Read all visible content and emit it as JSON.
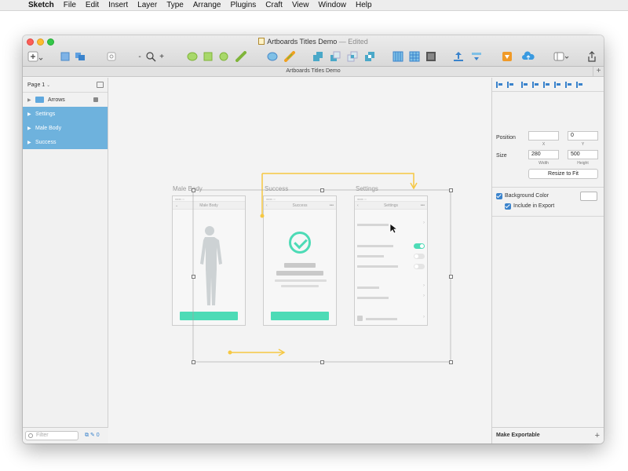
{
  "menubar": {
    "app": "Sketch",
    "items": [
      "File",
      "Edit",
      "Insert",
      "Layer",
      "Type",
      "Arrange",
      "Plugins",
      "Craft",
      "View",
      "Window",
      "Help"
    ]
  },
  "window": {
    "title": "Artboards Titles Demo",
    "edited": "— Edited",
    "tab_title": "Artboards Titles Demo"
  },
  "toolbar": {
    "icons": [
      "insert-icon",
      "group-icon",
      "ungroup-icon",
      "create-symbol-icon",
      "zoom-out-icon",
      "zoom-icon",
      "zoom-in-icon",
      "edit-icon",
      "transform-icon",
      "rotate-icon",
      "flatten-icon",
      "mask-icon",
      "scale-icon",
      "union-icon",
      "subtract-icon",
      "intersect-icon",
      "difference-icon",
      "forward-icon",
      "backward-icon",
      "mirror-icon",
      "view-icon",
      "export-icon",
      "cloud-icon",
      "sketch-icon"
    ],
    "zoom_minus": "-",
    "zoom_plus": "+"
  },
  "leftpanel": {
    "page_label": "Page 1",
    "layers": [
      {
        "label": "Arrows",
        "selected": false,
        "locked": true
      },
      {
        "label": "Settings",
        "selected": true
      },
      {
        "label": "Male Body",
        "selected": true
      },
      {
        "label": "Success",
        "selected": true
      }
    ],
    "filter_placeholder": "Filter",
    "footer_count": "0"
  },
  "canvas": {
    "artboards": [
      {
        "title": "Male Body",
        "nav_title": "Male Body",
        "status": "●●●○○",
        "time": "9:41"
      },
      {
        "title": "Success",
        "nav_title": "Success",
        "status": "●●●○○",
        "time": "9:41"
      },
      {
        "title": "Settings",
        "nav_title": "Settings",
        "status": "●●●○○",
        "time": "9:41"
      }
    ],
    "colors": {
      "accent": "#4ddbb6",
      "arrow": "#f6c843",
      "selection_blue": "#6eb2dd"
    }
  },
  "inspector": {
    "position_label": "Position",
    "x_value": "",
    "y_value": "0",
    "x_label": "X",
    "y_label": "Y",
    "size_label": "Size",
    "width_value": "280",
    "height_value": "500",
    "width_label": "Width",
    "height_label": "Height",
    "resize_button": "Resize to Fit",
    "background_color_label": "Background Color",
    "include_export_label": "Include in Export",
    "make_exportable": "Make Exportable"
  }
}
